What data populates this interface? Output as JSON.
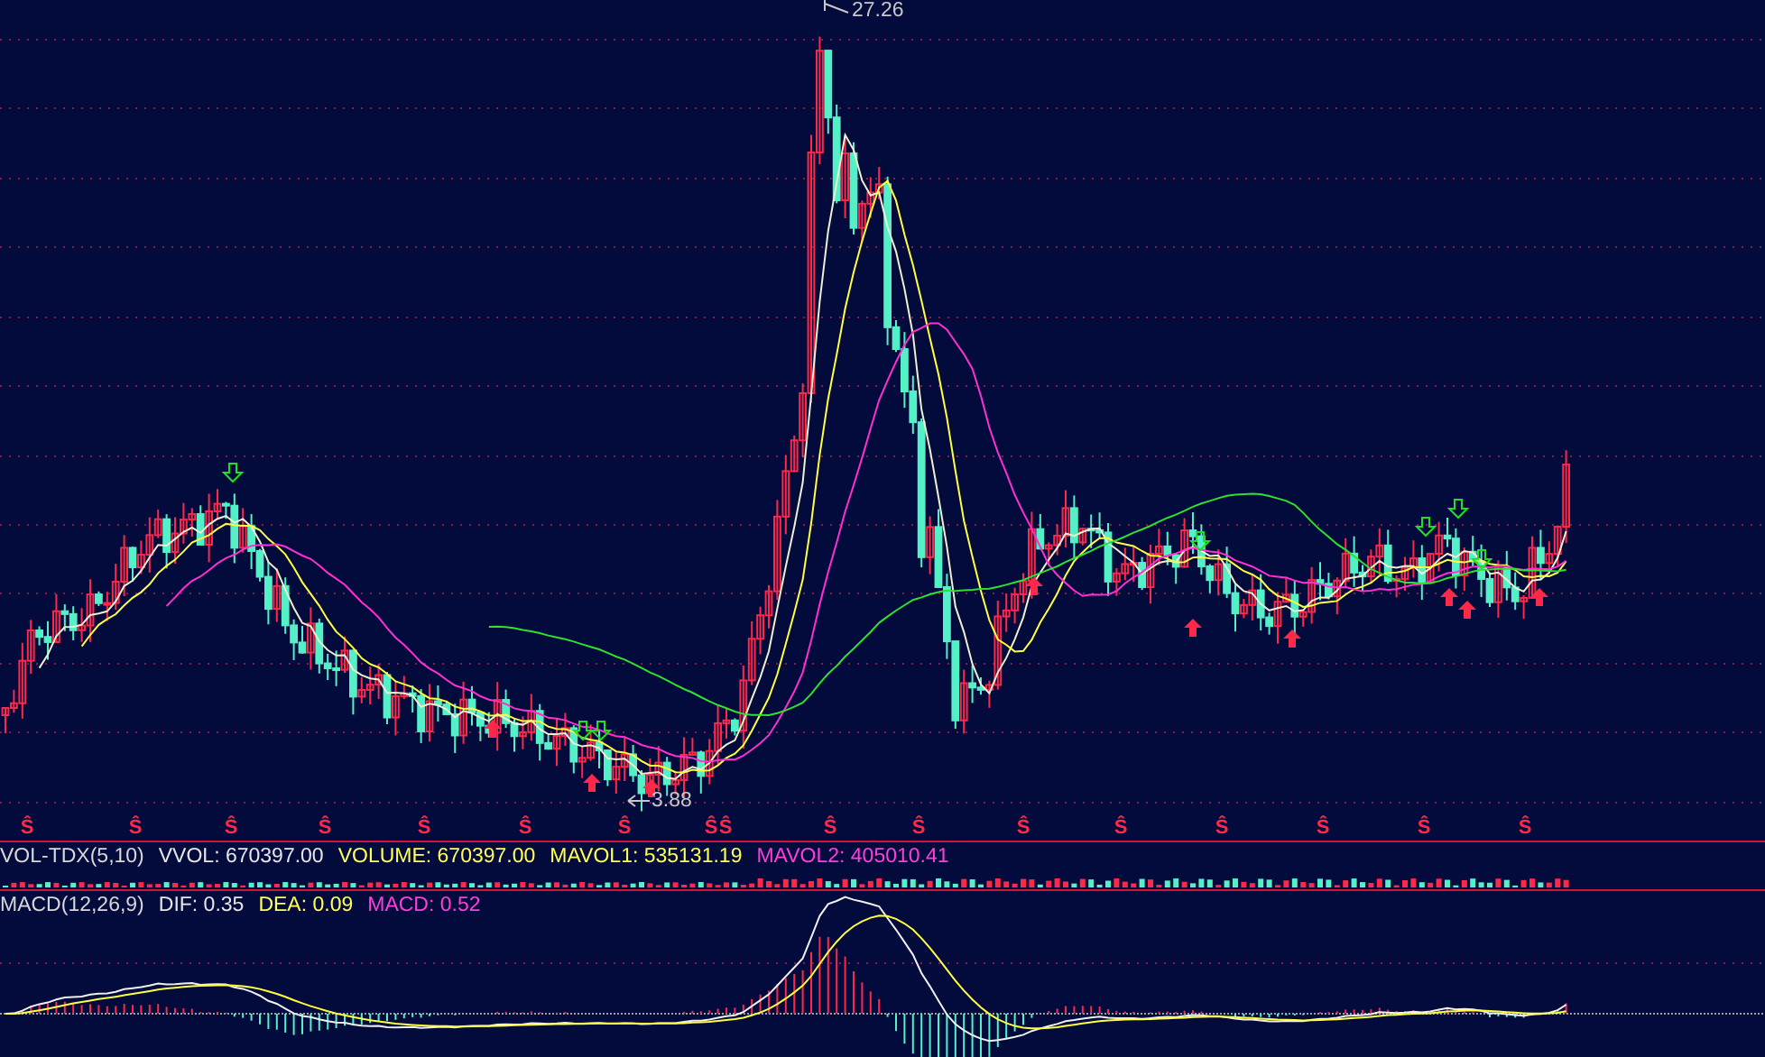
{
  "main_chart": {
    "high_label": "27.26",
    "low_label": "3.88",
    "markers": [
      "Ŝ",
      "Ŝ",
      "Ŝ",
      "Ŝ",
      "Ŝ",
      "Ŝ",
      "Ŝ",
      "Ŝ",
      "Ŝ",
      "Ŝ",
      "Ŝ",
      "Ŝ",
      "Ŝ",
      "Ŝ",
      "Ŝ",
      "Ŝ",
      "Ŝ"
    ]
  },
  "volume_panel": {
    "title": "VOL-TDX(5,10)",
    "values": [
      {
        "text": "VVOL: 670397.00",
        "color": "#e6e6e6"
      },
      {
        "text": "VOLUME: 670397.00",
        "color": "#ffff54"
      },
      {
        "text": "MAVOL1: 535131.19",
        "color": "#ffff54"
      },
      {
        "text": "MAVOL2: 405010.41",
        "color": "#ff3fd8"
      }
    ]
  },
  "macd_panel": {
    "title": "MACD(12,26,9)",
    "values": [
      {
        "text": "DIF: 0.35",
        "color": "#e6e6e6"
      },
      {
        "text": "DEA: 0.09",
        "color": "#ffff54"
      },
      {
        "text": "MACD: 0.52",
        "color": "#ff3fd8"
      }
    ]
  }
}
